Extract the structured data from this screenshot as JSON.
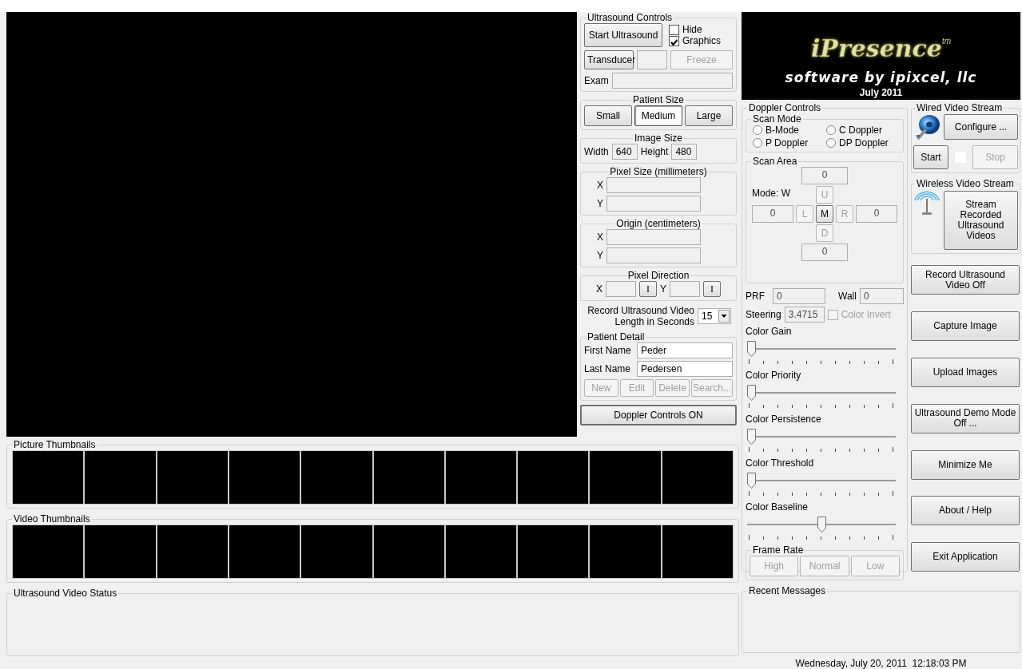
{
  "ultrasound_controls": {
    "title": "Ultrasound Controls",
    "start_button": "Start Ultrasound",
    "checkboxes": [
      {
        "label": "Hide",
        "checked": false
      },
      {
        "label": "Graphics",
        "checked": true
      }
    ],
    "transducer_button": "Transducer",
    "freeze_button": {
      "label": "Freeze",
      "disabled": true
    },
    "exam_label": "Exam"
  },
  "patient_size": {
    "title": "Patient Size",
    "options": [
      {
        "label": "Small",
        "selected": false
      },
      {
        "label": "Medium",
        "selected": true
      },
      {
        "label": "Large",
        "selected": false
      }
    ]
  },
  "image_size": {
    "title": "Image Size",
    "fields": [
      {
        "label": "Width",
        "value": "640"
      },
      {
        "label": "Height",
        "value": "480"
      }
    ]
  },
  "pixel_size": {
    "title": "Pixel Size (millimeters)",
    "fields": [
      {
        "label": "X"
      },
      {
        "label": "Y"
      }
    ]
  },
  "origin": {
    "title": "Origin (centimeters)",
    "fields": [
      {
        "label": "X"
      },
      {
        "label": "Y"
      }
    ]
  },
  "pixel_direction": {
    "title": "Pixel Direction",
    "fields": [
      {
        "label": "X",
        "button": "I"
      },
      {
        "label": "Y",
        "button": "I"
      }
    ]
  },
  "record_length": {
    "label": "Record Ultrasound Video Length in Seconds",
    "value": "15"
  },
  "patient_detail": {
    "title": "Patient Detail",
    "fields": [
      {
        "label": "First Name",
        "value": "Peder"
      },
      {
        "label": "Last Name",
        "value": "Pedersen"
      }
    ],
    "buttons": [
      {
        "label": "New",
        "disabled": true
      },
      {
        "label": "Edit",
        "disabled": true
      },
      {
        "label": "Delete",
        "disabled": true
      },
      {
        "label": "Search...",
        "disabled": true
      }
    ]
  },
  "doppler_toggle_button": "Doppler Controls ON",
  "picture_thumbnails": {
    "title": "Picture Thumbnails"
  },
  "video_thumbnails": {
    "title": "Video Thumbnails"
  },
  "video_status": {
    "title": "Ultrasound Video Status"
  },
  "logo": {
    "name": "iPresence",
    "mark": "tm",
    "tagline": "software by ipixcel, llc",
    "date": "July 2011"
  },
  "doppler_controls": {
    "title": "Doppler Controls",
    "scan_mode": {
      "title": "Scan Mode",
      "options": [
        {
          "label": "B-Mode",
          "selected": false
        },
        {
          "label": "C Doppler",
          "selected": false
        },
        {
          "label": "P Doppler",
          "selected": false
        },
        {
          "label": "DP Doppler",
          "selected": false
        }
      ]
    },
    "scan_area": {
      "title": "Scan Area",
      "mode": "Mode: W",
      "fields": [
        "0",
        "0",
        "0",
        "0"
      ],
      "pad": [
        {
          "label": "U",
          "disabled": true
        },
        {
          "label": "L",
          "disabled": true
        },
        {
          "label": "M",
          "disabled": false
        },
        {
          "label": "R",
          "disabled": true
        },
        {
          "label": "D",
          "disabled": true
        }
      ]
    },
    "prf": {
      "label": "PRF",
      "value": "0"
    },
    "wall": {
      "label": "Wall",
      "value": "0"
    },
    "steering": {
      "label": "Steering",
      "value": "3.4715"
    },
    "color_invert": {
      "label": "Color Invert",
      "checked": false,
      "disabled": true
    },
    "sliders": [
      {
        "label": "Color Gain",
        "level": 0
      },
      {
        "label": "Color Priority",
        "level": 0
      },
      {
        "label": "Color Persistence",
        "level": 0
      },
      {
        "label": "Color Threshold",
        "level": 0
      },
      {
        "label": "Color Baseline",
        "level": 0.5
      }
    ],
    "frame_rate": {
      "title": "Frame Rate",
      "buttons": [
        {
          "label": "High",
          "disabled": true
        },
        {
          "label": "Normal",
          "disabled": true
        },
        {
          "label": "Low",
          "disabled": true
        }
      ]
    }
  },
  "wired_video_stream": {
    "title": "Wired Video Stream",
    "configure_button": "Configure ...",
    "start_button": "Start",
    "stop_button": {
      "label": "Stop",
      "disabled": true
    }
  },
  "wireless_video_stream": {
    "title": "Wireless Video Stream",
    "stream_button": "Stream Recorded Ultrasound Videos"
  },
  "action_buttons": [
    "Record Ultrasound Video Off",
    "Capture Image",
    "Upload Images",
    "Ultrasound Demo Mode Off ...",
    "Minimize Me",
    "About / Help",
    "Exit Application"
  ],
  "recent_messages": {
    "title": "Recent Messages"
  },
  "status_bar": {
    "datetime": "Wednesday, July 20, 2011  12:18:03 PM"
  }
}
